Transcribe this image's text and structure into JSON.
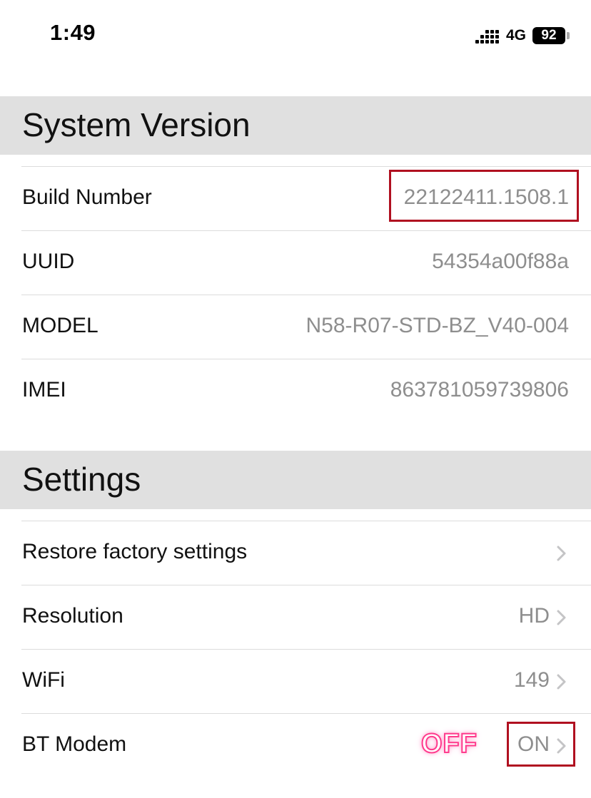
{
  "status_bar": {
    "time": "1:49",
    "network": "4G",
    "battery": "92"
  },
  "system_version": {
    "title": "System Version",
    "rows": [
      {
        "label": "Build Number",
        "value": "22122411.1508.1"
      },
      {
        "label": "UUID",
        "value": "54354a00f88a"
      },
      {
        "label": "MODEL",
        "value": "N58-R07-STD-BZ_V40-004"
      },
      {
        "label": "IMEI",
        "value": "863781059739806"
      }
    ]
  },
  "settings": {
    "title": "Settings",
    "rows": [
      {
        "label": "Restore factory settings",
        "value": ""
      },
      {
        "label": "Resolution",
        "value": "HD"
      },
      {
        "label": "WiFi",
        "value": "149"
      },
      {
        "label": "BT Modem",
        "value": "ON"
      }
    ]
  },
  "annotation": {
    "overlay_text": "OFF",
    "highlight_color": "#b01020",
    "overlay_color": "#ff3b8d"
  }
}
